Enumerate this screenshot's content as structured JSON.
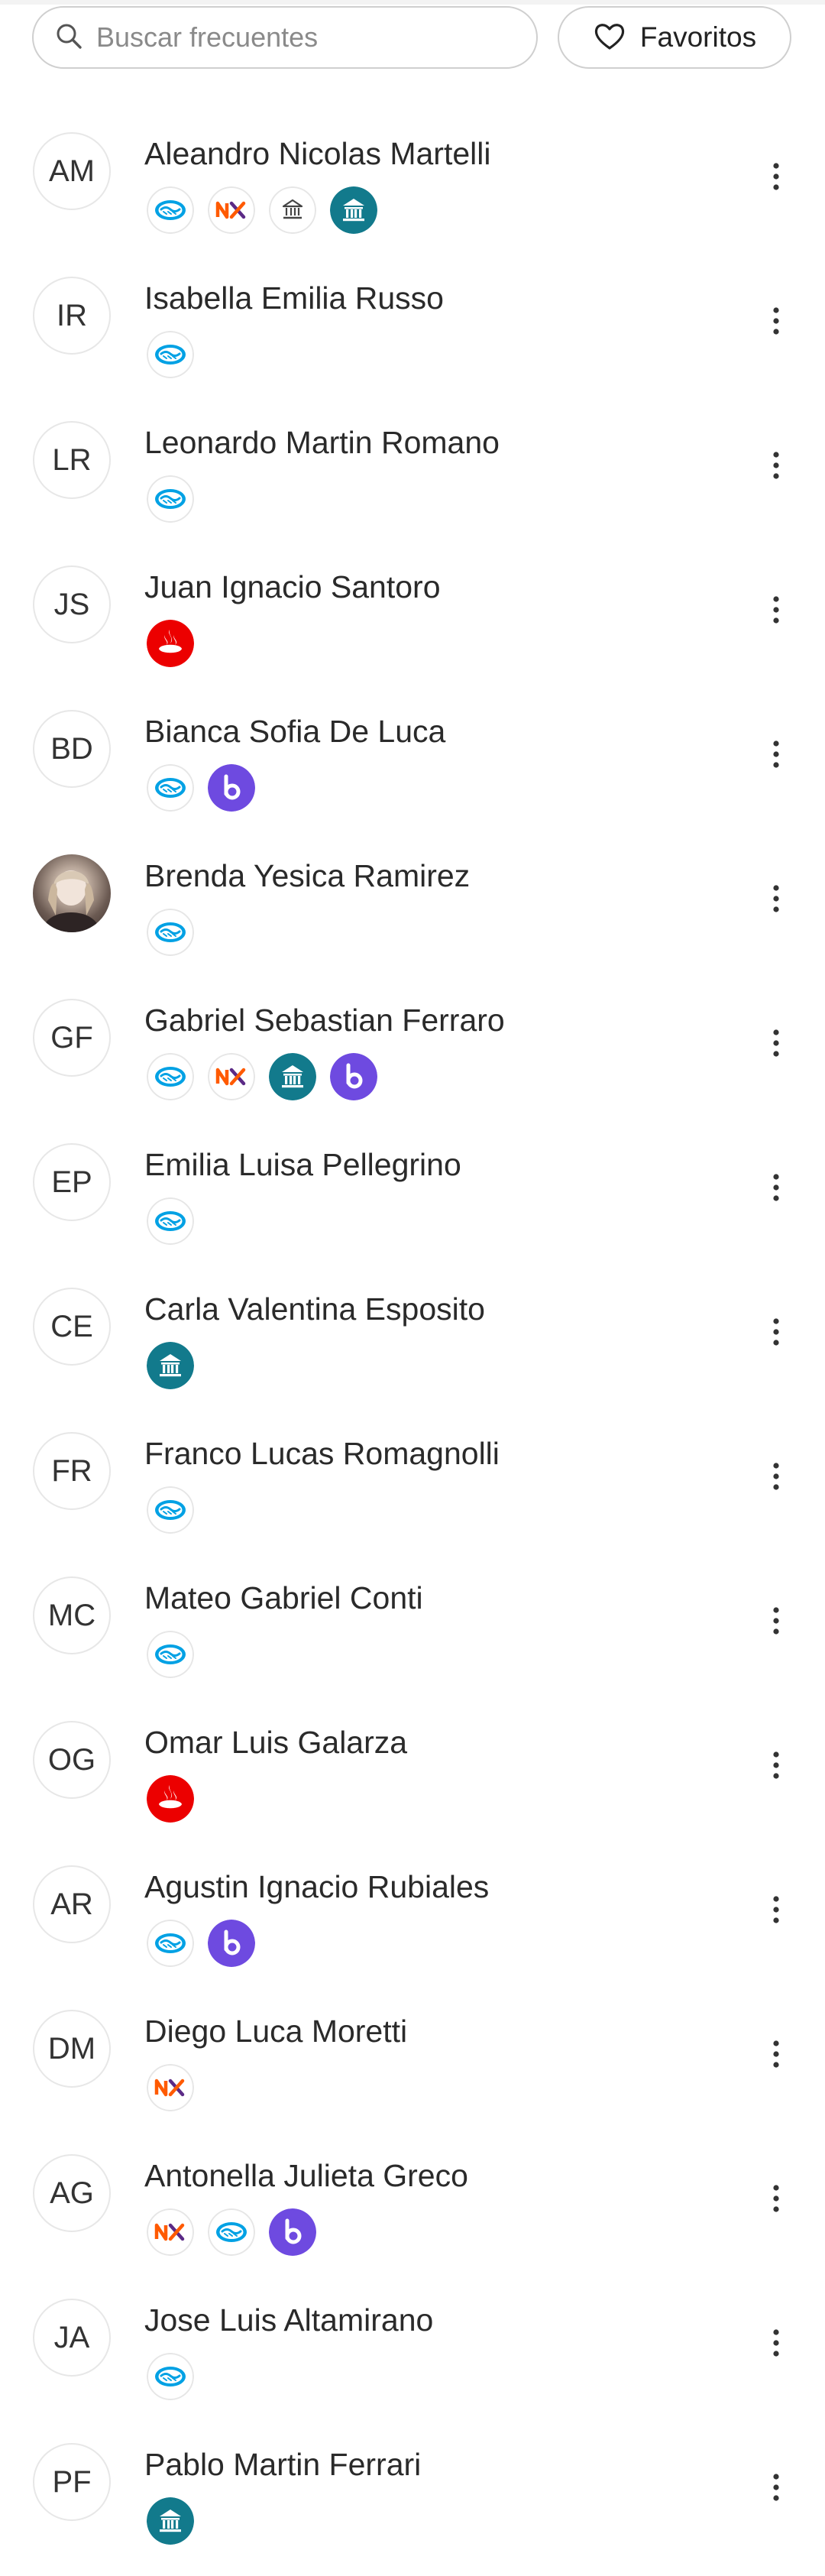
{
  "search": {
    "placeholder": "Buscar frecuentes",
    "icon": "search-icon"
  },
  "favorites": {
    "label": "Favoritos",
    "icon": "heart-icon"
  },
  "bank_icons": {
    "mp": "mercadopago-icon",
    "nx": "naranja-x-icon",
    "bank_outline": "bank-outline-icon",
    "bank_teal": "bank-icon",
    "santander": "santander-icon",
    "b": "brubank-icon"
  },
  "colors": {
    "mp_blue": "#00a1e4",
    "nx_orange": "#ff5a00",
    "nx_purple": "#5b2a86",
    "bank_teal": "#127a8c",
    "santander_red": "#ec0000",
    "brubank_purple": "#6e4ae0"
  },
  "contacts": [
    {
      "initials": "AM",
      "name": "Aleandro Nicolas Martelli",
      "banks": [
        "mp",
        "nx",
        "bank_outline",
        "bank_teal"
      ]
    },
    {
      "initials": "IR",
      "name": "Isabella Emilia Russo",
      "banks": [
        "mp"
      ]
    },
    {
      "initials": "LR",
      "name": "Leonardo Martin Romano",
      "banks": [
        "mp"
      ]
    },
    {
      "initials": "JS",
      "name": "Juan Ignacio Santoro",
      "banks": [
        "santander"
      ]
    },
    {
      "initials": "BD",
      "name": "Bianca Sofia De Luca",
      "banks": [
        "mp",
        "b"
      ]
    },
    {
      "initials": "",
      "photo": true,
      "name": "Brenda Yesica Ramirez",
      "banks": [
        "mp"
      ]
    },
    {
      "initials": "GF",
      "name": "Gabriel Sebastian Ferraro",
      "banks": [
        "mp",
        "nx",
        "bank_teal",
        "b"
      ]
    },
    {
      "initials": "EP",
      "name": "Emilia Luisa Pellegrino",
      "banks": [
        "mp"
      ]
    },
    {
      "initials": "CE",
      "name": "Carla Valentina Esposito",
      "banks": [
        "bank_teal"
      ]
    },
    {
      "initials": "FR",
      "name": "Franco Lucas Romagnolli",
      "banks": [
        "mp"
      ]
    },
    {
      "initials": "MC",
      "name": "Mateo Gabriel Conti",
      "banks": [
        "mp"
      ]
    },
    {
      "initials": "OG",
      "name": "Omar Luis Galarza",
      "banks": [
        "santander"
      ]
    },
    {
      "initials": "AR",
      "name": "Agustin Ignacio Rubiales",
      "banks": [
        "mp",
        "b"
      ]
    },
    {
      "initials": "DM",
      "name": "Diego Luca Moretti",
      "banks": [
        "nx"
      ]
    },
    {
      "initials": "AG",
      "name": "Antonella Julieta Greco",
      "banks": [
        "nx",
        "mp",
        "b"
      ]
    },
    {
      "initials": "JA",
      "name": "Jose Luis Altamirano",
      "banks": [
        "mp"
      ]
    },
    {
      "initials": "PF",
      "name": "Pablo Martin Ferrari",
      "banks": [
        "bank_teal"
      ]
    }
  ]
}
